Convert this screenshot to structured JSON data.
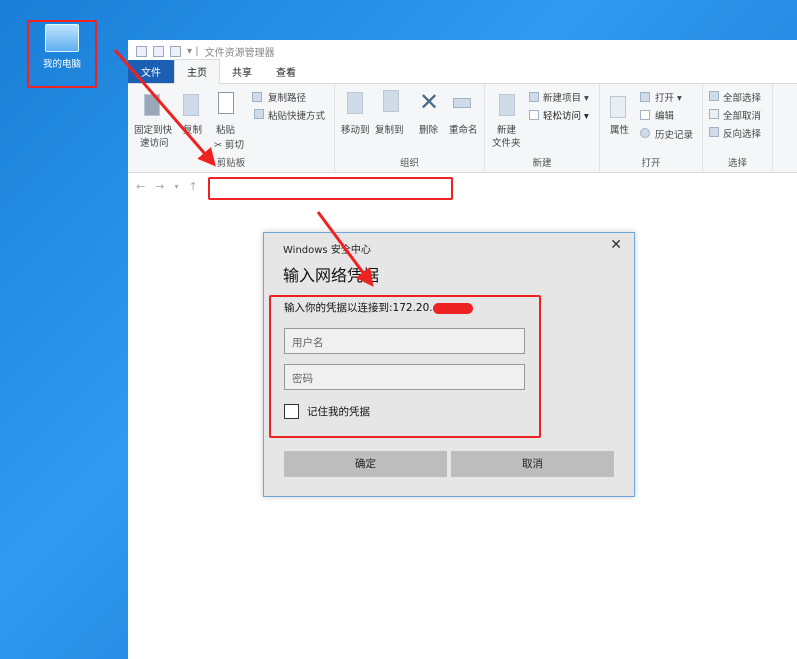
{
  "desktop": {
    "icon_label": "我的电脑"
  },
  "explorer": {
    "title": "文件资源管理器",
    "tabs": [
      "文件",
      "主页",
      "共享",
      "查看"
    ],
    "ribbon": {
      "clipboard": {
        "label": "剪贴板",
        "pin": "固定到快速访问",
        "pin2": "速访问",
        "pin1": "固定到快",
        "copy": "复制",
        "paste": "粘贴",
        "copy_path": "复制路径",
        "paste_shortcut": "粘贴快捷方式",
        "cut": "剪切"
      },
      "organize": {
        "label": "组织",
        "move_to": "移动到",
        "copy_to": "复制到",
        "delete": "删除",
        "rename": "重命名"
      },
      "new": {
        "label": "新建",
        "new_folder1": "新建",
        "new_folder2": "文件夹",
        "new_item": "新建项目 ▾",
        "easy_access": "轻松访问 ▾"
      },
      "open": {
        "label": "打开",
        "properties": "属性",
        "open": "打开 ▾",
        "edit": "编辑",
        "history": "历史记录"
      },
      "select": {
        "label": "选择",
        "select_all": "全部选择",
        "select_none": "全部取消",
        "invert": "反向选择"
      }
    },
    "address_value": ""
  },
  "dialog": {
    "app": "Windows 安全中心",
    "title": "输入网络凭据",
    "message": "输入你的凭据以连接到:172.20.",
    "username_placeholder": "用户名",
    "password_placeholder": "密码",
    "remember": "记住我的凭据",
    "ok": "确定",
    "cancel": "取消"
  },
  "colors": {
    "annotation": "#e22222",
    "file_tab": "#1a5fb4"
  }
}
